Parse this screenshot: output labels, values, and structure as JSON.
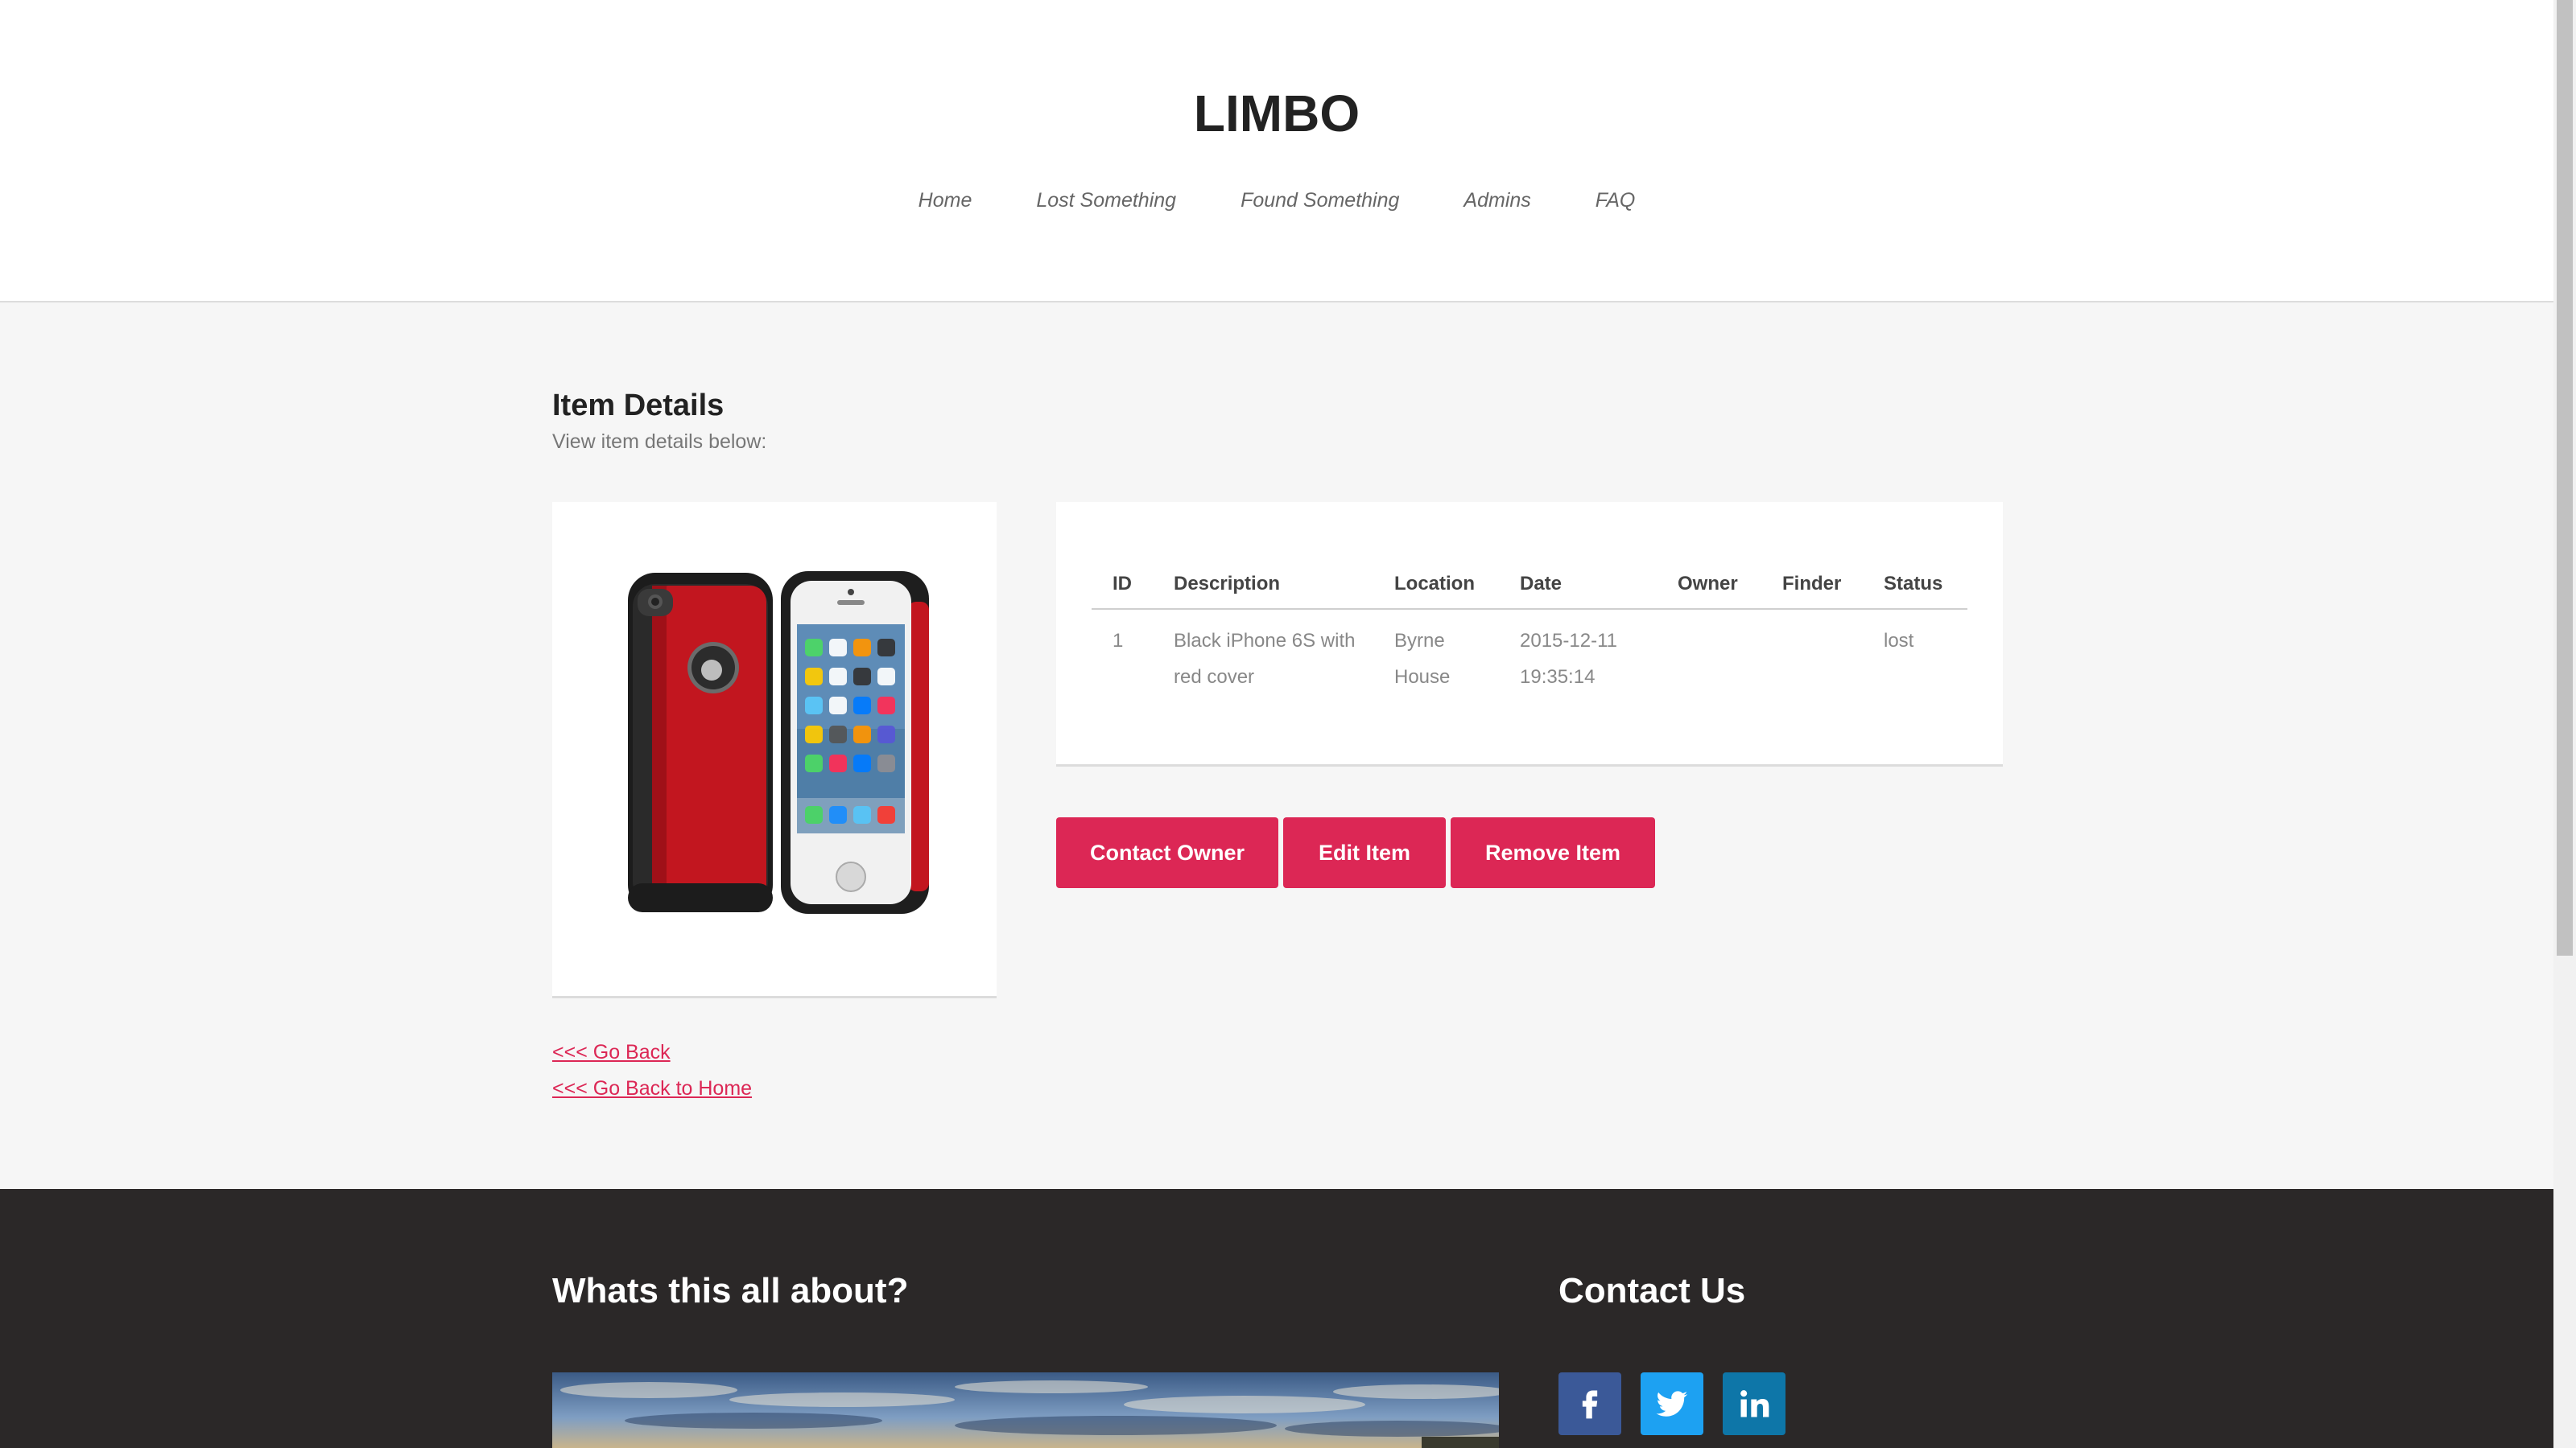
{
  "site": {
    "brand": "LIMBO"
  },
  "nav": {
    "items": [
      {
        "label": "Home"
      },
      {
        "label": "Lost Something"
      },
      {
        "label": "Found Something"
      },
      {
        "label": "Admins"
      },
      {
        "label": "FAQ"
      }
    ]
  },
  "main": {
    "title": "Item Details",
    "subtitle": "View item details below:",
    "table": {
      "headers": [
        "ID",
        "Description",
        "Location",
        "Date",
        "Owner",
        "Finder",
        "Status"
      ],
      "rows": [
        {
          "id": "1",
          "description": "Black iPhone 6S with red cover",
          "location": "Byrne House",
          "date": "2015-12-11 19:35:14",
          "owner": "",
          "finder": "",
          "status": "lost"
        }
      ]
    },
    "actions": {
      "contact_owner": "Contact Owner",
      "edit_item": "Edit Item",
      "remove_item": "Remove Item"
    },
    "links": {
      "go_back": "<<< Go Back",
      "go_back_home": "<<< Go Back to Home"
    }
  },
  "footer": {
    "about_title": "Whats this all about?",
    "contact_title": "Contact Us",
    "social": [
      {
        "icon": "facebook-icon",
        "glyph": "f"
      },
      {
        "icon": "twitter-icon",
        "glyph": ""
      },
      {
        "icon": "linkedin-icon",
        "glyph": "in"
      }
    ]
  },
  "colors": {
    "accent": "#dc2755",
    "header_bg": "#ffffff",
    "page_bg": "#f6f6f6",
    "footer_bg": "#2b2828",
    "facebook": "#3b5998",
    "twitter": "#1da1f2",
    "linkedin": "#0e76a8"
  }
}
